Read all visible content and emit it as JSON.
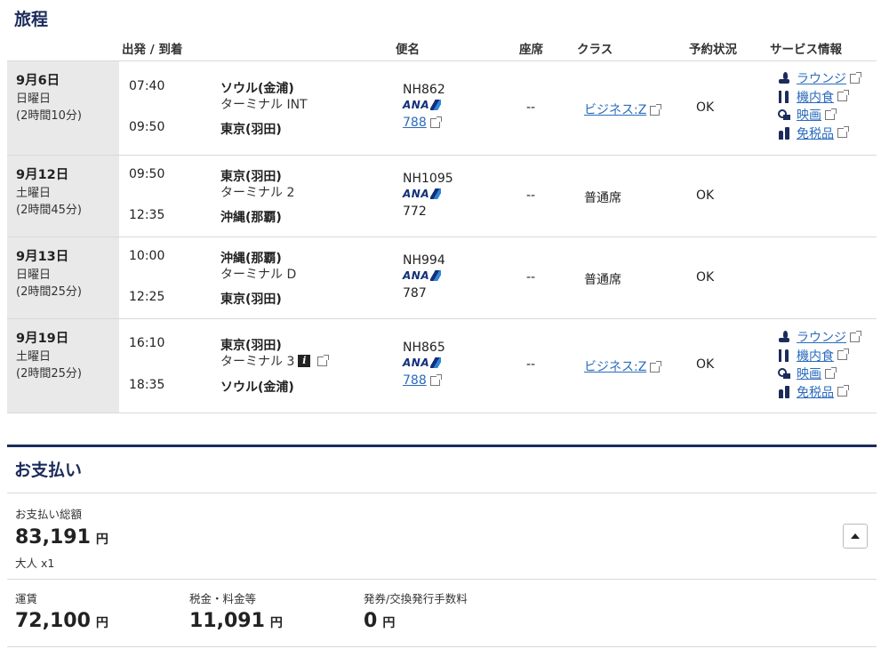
{
  "itinerary": {
    "title": "旅程",
    "headers": {
      "depart_arrive": "出発 / 到着",
      "flight": "便名",
      "seat": "座席",
      "class": "クラス",
      "status": "予約状況",
      "services": "サービス情報"
    },
    "trips": [
      {
        "date": "9月6日",
        "weekday": "日曜日",
        "duration": "(2時間10分)",
        "dep_time": "07:40",
        "dep_airport": "ソウル(金浦)",
        "terminal": "ターミナル INT",
        "arr_time": "09:50",
        "arr_airport": "東京(羽田)",
        "flight_no": "NH862",
        "airline": "ANA",
        "aircraft": "788",
        "seat": "--",
        "class": "ビジネス:Z",
        "status": "OK",
        "services": [
          "ラウンジ",
          "機内食",
          "映画",
          "免税品"
        ]
      },
      {
        "date": "9月12日",
        "weekday": "土曜日",
        "duration": "(2時間45分)",
        "dep_time": "09:50",
        "dep_airport": "東京(羽田)",
        "terminal": "ターミナル 2",
        "arr_time": "12:35",
        "arr_airport": "沖縄(那覇)",
        "flight_no": "NH1095",
        "airline": "ANA",
        "aircraft": "772",
        "seat": "--",
        "class": "普通席",
        "status": "OK"
      },
      {
        "date": "9月13日",
        "weekday": "日曜日",
        "duration": "(2時間25分)",
        "dep_time": "10:00",
        "dep_airport": "沖縄(那覇)",
        "terminal": "ターミナル D",
        "arr_time": "12:25",
        "arr_airport": "東京(羽田)",
        "flight_no": "NH994",
        "airline": "ANA",
        "aircraft": "787",
        "seat": "--",
        "class": "普通席",
        "status": "OK"
      },
      {
        "date": "9月19日",
        "weekday": "土曜日",
        "duration": "(2時間25分)",
        "dep_time": "16:10",
        "dep_airport": "東京(羽田)",
        "terminal": "ターミナル 3",
        "arr_time": "18:35",
        "arr_airport": "ソウル(金浦)",
        "flight_no": "NH865",
        "airline": "ANA",
        "aircraft": "788",
        "seat": "--",
        "class": "ビジネス:Z",
        "status": "OK",
        "services": [
          "ラウンジ",
          "機内食",
          "映画",
          "免税品"
        ]
      }
    ]
  },
  "payment": {
    "title": "お支払い",
    "total_label": "お支払い総額",
    "total_amount": "83,191",
    "currency": "円",
    "passengers": "大人 x1",
    "fare_label": "運賃",
    "fare_amount": "72,100",
    "tax_label": "税金・料金等",
    "tax_amount": "11,091",
    "fee_label": "発券/交換発行手数料",
    "fee_amount": "0"
  },
  "colors": {
    "navy": "#1b2b5b",
    "link": "#2a6bbd",
    "date_bg": "#e9e9e9"
  }
}
